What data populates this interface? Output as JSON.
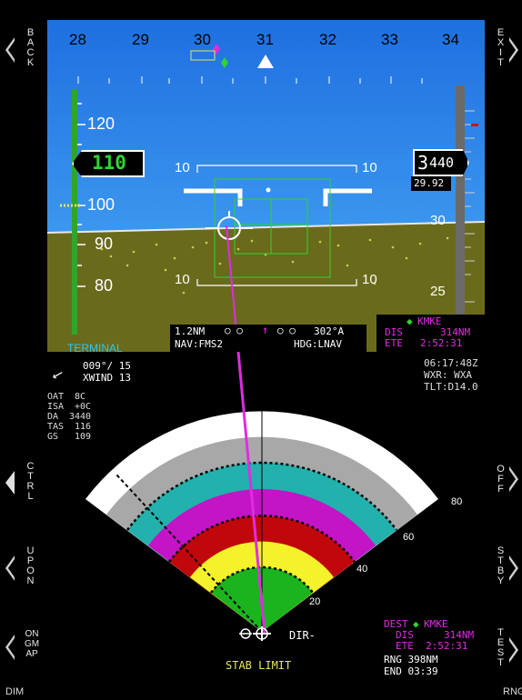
{
  "side_buttons": {
    "left": [
      {
        "label": "BACK"
      },
      {
        "label": "CTRL"
      },
      {
        "label": "UP ON"
      },
      {
        "label": "ON GMAP"
      }
    ],
    "right": [
      {
        "label": "EXIT"
      },
      {
        "label": "OFF"
      },
      {
        "label": "STBY"
      },
      {
        "label": "TEST"
      }
    ],
    "bottom_left": "DIM",
    "bottom_right": "RNG"
  },
  "heading_tape": {
    "labels": [
      "28",
      "29",
      "30",
      "31",
      "32",
      "33",
      "34"
    ],
    "current_heading": 31
  },
  "airspeed": {
    "current": "110",
    "ticks": [
      "120",
      "100",
      "90",
      "80"
    ]
  },
  "altitude": {
    "current_big": "3",
    "current_small": "440",
    "baro": "29.92",
    "ticks": [
      "30",
      "25"
    ]
  },
  "pitch_ladder": {
    "upper": "10",
    "lower": "10"
  },
  "nav_box": {
    "distance": "1.2NM",
    "course": "302°A",
    "nav_source": "NAV:FMS2",
    "heading_mode": "HDG:LNAV"
  },
  "waypoint_top": {
    "ident": "KMKE",
    "dis_label": "DIS",
    "dis_value": "314NM",
    "ete_label": "ETE",
    "ete_value": "2:52:31"
  },
  "mode_label": "TERMINAL",
  "wind": {
    "dir_speed": "009°/ 15",
    "xwind": "XWIND 13"
  },
  "air_data": [
    {
      "label": "OAT",
      "value": "8C"
    },
    {
      "label": "ISA",
      "value": "+0C"
    },
    {
      "label": "DA",
      "value": "3440"
    },
    {
      "label": "TAS",
      "value": "116"
    },
    {
      "label": "GS",
      "value": "109"
    }
  ],
  "status_right": {
    "time": "06:17:48Z",
    "wxr": "WXR:  WXA",
    "tlt": "TLT:D14.0"
  },
  "radar": {
    "range_labels": [
      "80",
      "60",
      "40",
      "20"
    ],
    "colors": {
      "white": "#ffffff",
      "gray": "#a8a8a8",
      "cyan": "#22b1ad",
      "magenta": "#c314c6",
      "red": "#c0080c",
      "yellow": "#f4f22a",
      "green": "#1bb31e"
    },
    "dir_label": "DIR-",
    "stab_label": "STAB LIMIT"
  },
  "dest_box": {
    "dest_label": "DEST",
    "ident": "KMKE",
    "dis_label": "DIS",
    "dis_value": "314NM",
    "ete_label": "ETE",
    "ete_value": "2:52:31",
    "rng": "RNG 398NM",
    "end": "END 03:39"
  },
  "colors": {
    "sky": "#2a86e6",
    "ground": "#6d6a1c",
    "magenta": "#e02ce0",
    "green_tape": "#2fa52b",
    "cyan_text": "#2cc8f0",
    "label_gray": "#d8d8d8"
  }
}
